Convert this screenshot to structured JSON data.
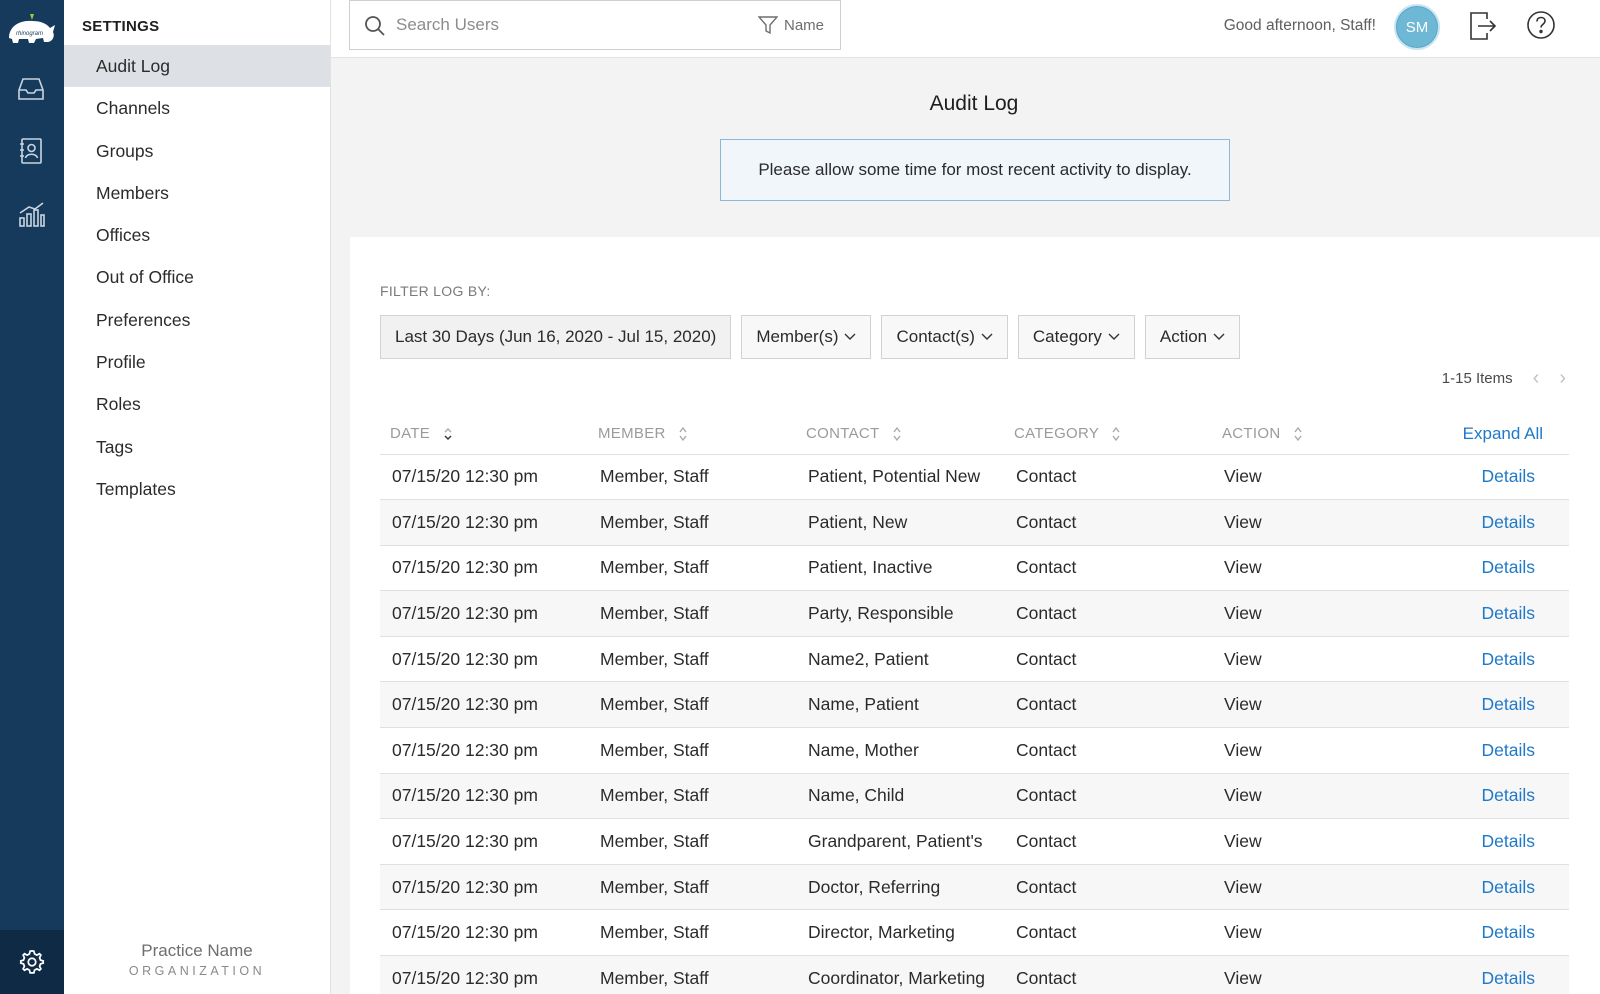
{
  "brand": {
    "logo_text": "rhinogram",
    "accent": "#1f78c8",
    "rail_color": "#163a5c"
  },
  "rail": {
    "items": [
      {
        "icon": "inbox-icon"
      },
      {
        "icon": "contacts-icon"
      },
      {
        "icon": "analytics-icon"
      }
    ],
    "settings_icon": "gear-icon"
  },
  "sidebar": {
    "title": "SETTINGS",
    "items": [
      {
        "label": "Audit Log",
        "active": true
      },
      {
        "label": "Channels"
      },
      {
        "label": "Groups"
      },
      {
        "label": "Members"
      },
      {
        "label": "Offices"
      },
      {
        "label": "Out of Office"
      },
      {
        "label": "Preferences"
      },
      {
        "label": "Profile"
      },
      {
        "label": "Roles"
      },
      {
        "label": "Tags"
      },
      {
        "label": "Templates"
      }
    ],
    "org": {
      "name": "Practice Name",
      "type": "ORGANIZATION"
    }
  },
  "topbar": {
    "search": {
      "placeholder": "Search Users",
      "value": "",
      "filter_label": "Name"
    },
    "greeting": "Good afternoon, Staff!",
    "avatar_initials": "SM"
  },
  "main": {
    "title": "Audit Log",
    "notice": "Please allow some time for most recent activity to display.",
    "filter_label": "FILTER LOG BY:",
    "filters": {
      "date": "Last 30 Days (Jun 16, 2020 - Jul 15, 2020)",
      "members": "Member(s)",
      "contacts": "Contact(s)",
      "category": "Category",
      "action": "Action"
    },
    "pager": {
      "items": "1-15 Items"
    },
    "table": {
      "headers": {
        "date": "DATE",
        "member": "MEMBER",
        "contact": "CONTACT",
        "category": "CATEGORY",
        "action": "ACTION",
        "expand_all": "Expand All"
      },
      "rows": [
        {
          "date": "07/15/20 12:30 pm",
          "member": "Member, Staff",
          "contact": "Patient, Potential New",
          "category": "Contact",
          "action": "View",
          "details": "Details"
        },
        {
          "date": "07/15/20 12:30 pm",
          "member": "Member, Staff",
          "contact": "Patient, New",
          "category": "Contact",
          "action": "View",
          "details": "Details"
        },
        {
          "date": "07/15/20 12:30 pm",
          "member": "Member, Staff",
          "contact": "Patient, Inactive",
          "category": "Contact",
          "action": "View",
          "details": "Details"
        },
        {
          "date": "07/15/20 12:30 pm",
          "member": "Member, Staff",
          "contact": "Party, Responsible",
          "category": "Contact",
          "action": "View",
          "details": "Details"
        },
        {
          "date": "07/15/20 12:30 pm",
          "member": "Member, Staff",
          "contact": "Name2, Patient",
          "category": "Contact",
          "action": "View",
          "details": "Details"
        },
        {
          "date": "07/15/20 12:30 pm",
          "member": "Member, Staff",
          "contact": "Name, Patient",
          "category": "Contact",
          "action": "View",
          "details": "Details"
        },
        {
          "date": "07/15/20 12:30 pm",
          "member": "Member, Staff",
          "contact": "Name, Mother",
          "category": "Contact",
          "action": "View",
          "details": "Details"
        },
        {
          "date": "07/15/20 12:30 pm",
          "member": "Member, Staff",
          "contact": "Name, Child",
          "category": "Contact",
          "action": "View",
          "details": "Details"
        },
        {
          "date": "07/15/20 12:30 pm",
          "member": "Member, Staff",
          "contact": "Grandparent, Patient's",
          "category": "Contact",
          "action": "View",
          "details": "Details"
        },
        {
          "date": "07/15/20 12:30 pm",
          "member": "Member, Staff",
          "contact": "Doctor, Referring",
          "category": "Contact",
          "action": "View",
          "details": "Details"
        },
        {
          "date": "07/15/20 12:30 pm",
          "member": "Member, Staff",
          "contact": "Director, Marketing",
          "category": "Contact",
          "action": "View",
          "details": "Details"
        },
        {
          "date": "07/15/20 12:30 pm",
          "member": "Member, Staff",
          "contact": "Coordinator, Marketing",
          "category": "Contact",
          "action": "View",
          "details": "Details"
        }
      ]
    }
  }
}
